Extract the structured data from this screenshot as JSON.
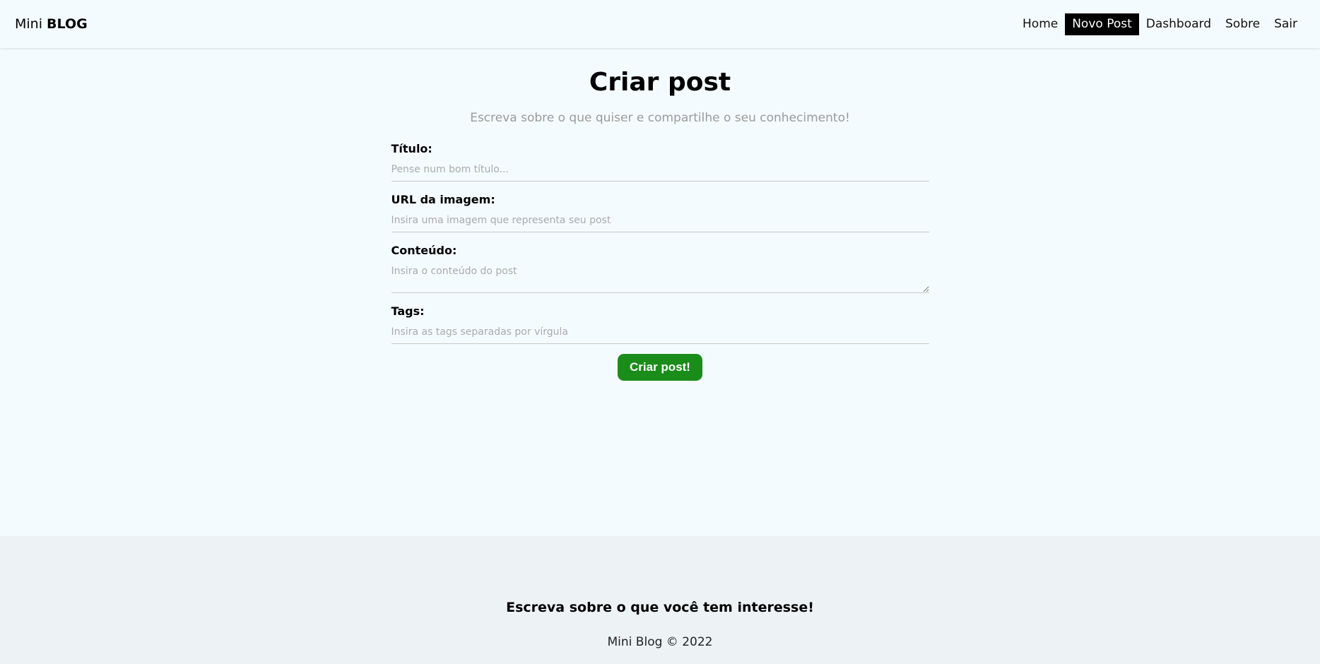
{
  "navbar": {
    "brand_prefix": "Mini",
    "brand_strong": "BLOG",
    "links": [
      {
        "label": "Home"
      },
      {
        "label": "Novo Post"
      },
      {
        "label": "Dashboard"
      },
      {
        "label": "Sobre"
      },
      {
        "label": "Sair"
      }
    ]
  },
  "page": {
    "title": "Criar post",
    "subtitle": "Escreva sobre o que quiser e compartilhe o seu conhecimento!"
  },
  "form": {
    "title_label": "Título:",
    "title_placeholder": "Pense num bom título...",
    "image_label": "URL da imagem:",
    "image_placeholder": "Insira uma imagem que representa seu post",
    "content_label": "Conteúdo:",
    "content_placeholder": "Insira o conteúdo do post",
    "tags_label": "Tags:",
    "tags_placeholder": "Insira as tags separadas por vírgula",
    "submit_label": "Criar post!"
  },
  "footer": {
    "headline": "Escreva sobre o que você tem interesse!",
    "copyright": "Mini Blog © 2022"
  },
  "colors": {
    "background": "#f4fbff",
    "footer_background": "#edf2f5",
    "active_nav": "#000000",
    "submit_button": "#1a8c1a"
  }
}
